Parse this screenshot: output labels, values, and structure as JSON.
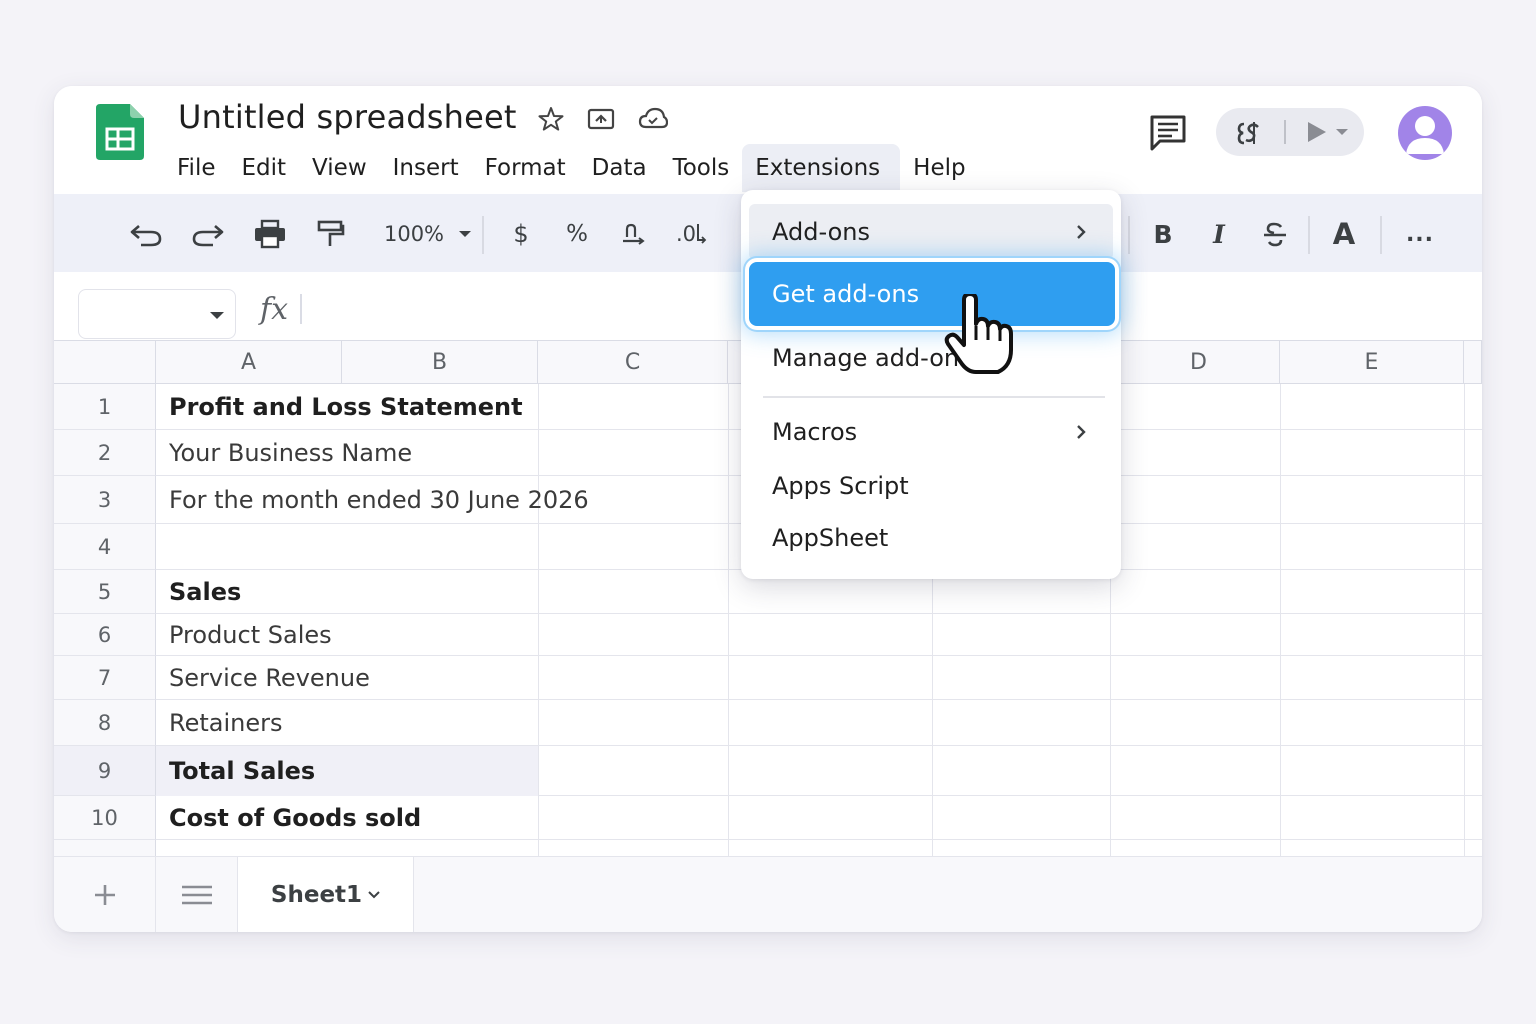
{
  "app": {
    "doc_title": "Untitled spreadsheet"
  },
  "menubar": {
    "items": [
      "File",
      "Edit",
      "View",
      "Insert",
      "Format",
      "Data",
      "Tools",
      "Extensions",
      "Help"
    ],
    "active": "Extensions"
  },
  "toolbar": {
    "zoom": "100%",
    "currency": "$",
    "percent": "%",
    "decimal": ".0",
    "bold": "B",
    "italic": "I",
    "text_color": "A",
    "more": "..."
  },
  "formula_bar": {
    "fx_label": "fx",
    "name_box_value": ""
  },
  "columns": [
    "A",
    "B",
    "C",
    "D",
    "E"
  ],
  "rows": [
    {
      "num": "1",
      "text": "Profit and Loss Statement",
      "bold": true
    },
    {
      "num": "2",
      "text": "Your Business Name",
      "bold": false
    },
    {
      "num": "3",
      "text": "For the month ended 30 June 2026",
      "bold": false
    },
    {
      "num": "4",
      "text": "",
      "bold": false
    },
    {
      "num": "5",
      "text": "Sales",
      "bold": true
    },
    {
      "num": "6",
      "text": "Product Sales",
      "bold": false
    },
    {
      "num": "7",
      "text": "Service Revenue",
      "bold": false
    },
    {
      "num": "8",
      "text": "Retainers",
      "bold": false
    },
    {
      "num": "9",
      "text": "Total Sales",
      "bold": true
    },
    {
      "num": "10",
      "text": "Cost of Goods sold",
      "bold": true
    }
  ],
  "sheets": {
    "active": "Sheet1"
  },
  "extensions_menu": {
    "items": [
      {
        "label": "Add-ons",
        "submenu": true
      },
      {
        "label": "Get add-ons",
        "selected": true
      },
      {
        "label": "Manage add-ons"
      },
      {
        "label": "Macros",
        "submenu": true
      },
      {
        "label": "Apps Script"
      },
      {
        "label": "AppSheet"
      }
    ]
  },
  "colors": {
    "sheets_green": "#23a566",
    "menu_selected": "#2f9ef0",
    "avatar": "#a184e8",
    "toolbar_bg": "#eef0f8"
  },
  "icons": [
    "star-icon",
    "move-to-folder-icon",
    "cloud-status-icon",
    "comments-icon",
    "appscript-icon",
    "present-icon",
    "account-avatar-icon",
    "undo-icon",
    "redo-icon",
    "print-icon",
    "paint-format-icon",
    "pointer-hand-icon"
  ]
}
